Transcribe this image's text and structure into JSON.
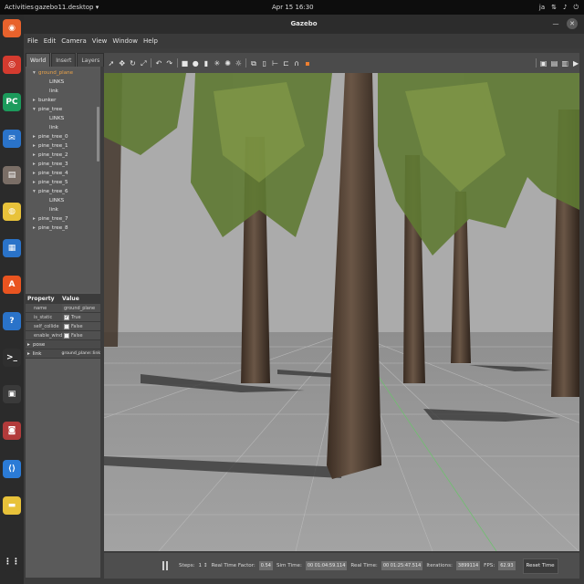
{
  "topbar": {
    "activities": "Activities",
    "app_menu": "gazebo11.desktop ▾",
    "clock": "Apr 15  16:30",
    "lang": "ja",
    "tray_icons": [
      "lang-indicator",
      "network-icon",
      "volume-icon",
      "power-icon"
    ]
  },
  "dock": {
    "items": [
      "firefox-icon",
      "chrome-icon",
      "pycharm-icon",
      "thunderbird-icon",
      "files-icon",
      "rhythmbox-icon",
      "writer-icon",
      "software-icon",
      "help-icon",
      "terminal-icon",
      "stacer-icon",
      "cheese-icon",
      "vscode-icon",
      "sticky-icon",
      "apps-grid-icon"
    ],
    "colors": [
      "#e8622c",
      "#d43b2f",
      "#1c9b5c",
      "#2a73c9",
      "#7a6e66",
      "#e8c23a",
      "#2a73c9",
      "#e95420",
      "#2a73c9",
      "#2f2f2f",
      "#3a3a3a",
      "#b23b3b",
      "#2b7bd6",
      "#e8c23a",
      "#2b2b2b"
    ]
  },
  "window": {
    "title": "Gazebo",
    "menu": [
      "File",
      "Edit",
      "Camera",
      "View",
      "Window",
      "Help"
    ]
  },
  "left": {
    "tabs": [
      "World",
      "Insert",
      "Layers"
    ],
    "tree": [
      {
        "label": "ground_plane",
        "indent": 1,
        "arrow": "▾",
        "highlight": true
      },
      {
        "label": "LINKS",
        "indent": 2,
        "arrow": "",
        "highlight": false
      },
      {
        "label": "link",
        "indent": 2,
        "arrow": "",
        "highlight": false
      },
      {
        "label": "bunker",
        "indent": 1,
        "arrow": "▸",
        "highlight": false
      },
      {
        "label": "pine_tree",
        "indent": 1,
        "arrow": "▾",
        "highlight": false
      },
      {
        "label": "LINKS",
        "indent": 2,
        "arrow": "",
        "highlight": false
      },
      {
        "label": "link",
        "indent": 2,
        "arrow": "",
        "highlight": false
      },
      {
        "label": "pine_tree_0",
        "indent": 1,
        "arrow": "▸",
        "highlight": false
      },
      {
        "label": "pine_tree_1",
        "indent": 1,
        "arrow": "▸",
        "highlight": false
      },
      {
        "label": "pine_tree_2",
        "indent": 1,
        "arrow": "▸",
        "highlight": false
      },
      {
        "label": "pine_tree_3",
        "indent": 1,
        "arrow": "▸",
        "highlight": false
      },
      {
        "label": "pine_tree_4",
        "indent": 1,
        "arrow": "▸",
        "highlight": false
      },
      {
        "label": "pine_tree_5",
        "indent": 1,
        "arrow": "▸",
        "highlight": false
      },
      {
        "label": "pine_tree_6",
        "indent": 1,
        "arrow": "▾",
        "highlight": false
      },
      {
        "label": "LINKS",
        "indent": 2,
        "arrow": "",
        "highlight": false
      },
      {
        "label": "link",
        "indent": 2,
        "arrow": "",
        "highlight": false
      },
      {
        "label": "pine_tree_7",
        "indent": 1,
        "arrow": "▸",
        "highlight": false
      },
      {
        "label": "pine_tree_8",
        "indent": 1,
        "arrow": "▸",
        "highlight": false
      }
    ],
    "props_header": [
      "Property",
      "Value"
    ],
    "props": [
      {
        "key": "name",
        "value": "ground_plane",
        "check": false,
        "checked": false
      },
      {
        "key": "is_static",
        "value": "True",
        "check": true,
        "checked": true
      },
      {
        "key": "self_collide",
        "value": "False",
        "check": true,
        "checked": false
      },
      {
        "key": "enable_wind",
        "value": "False",
        "check": true,
        "checked": false
      }
    ],
    "pose_label": "pose",
    "link_label": "link",
    "link_value": "ground_plane::link"
  },
  "toolbar": {
    "icons": [
      "select-arrow-icon",
      "translate-icon",
      "rotate-icon",
      "scale-icon",
      "undo-icon",
      "redo-icon",
      "box-icon",
      "sphere-icon",
      "cylinder-icon",
      "point-light-icon",
      "spot-light-icon",
      "directional-light-icon",
      "copy-icon",
      "paste-icon",
      "align-icon",
      "snap-icon",
      "magnet-icon",
      "orange-view-icon",
      "screenshot-icon",
      "log-icon",
      "plot-icon",
      "video-icon"
    ]
  },
  "bottom": {
    "steps_label": "Steps:",
    "steps_value": "1 ↕",
    "rtf_label": "Real Time Factor:",
    "rtf_value": "0.54",
    "sim_label": "Sim Time:",
    "sim_value": "00 01:04:59.114",
    "real_label": "Real Time:",
    "real_value": "00 01:25:47.514",
    "iter_label": "Iterations:",
    "iter_value": "3899114",
    "fps_label": "FPS:",
    "fps_value": "62.93",
    "reset_label": "Reset Time"
  },
  "colors": {
    "sky": "#ababab",
    "ground": "#9c9c9c",
    "bark": "#4f3e30",
    "foliage": "#5f7a33",
    "highlight": "#e8a24a"
  }
}
